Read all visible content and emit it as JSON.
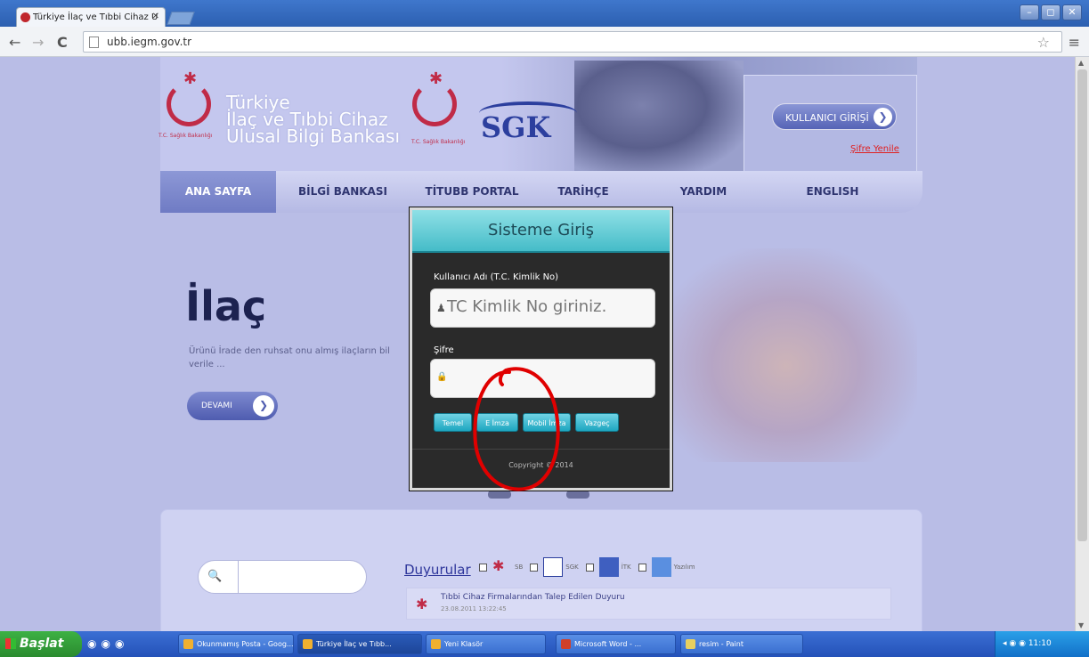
{
  "browser": {
    "tab_title": "Türkiye İlaç ve Tıbbi Cihaz U",
    "tab_close": "✕",
    "url": "ubb.iegm.gov.tr",
    "nav_back": "←",
    "nav_forward": "→",
    "nav_reload": "C",
    "star": "☆",
    "menu": "≡",
    "win_min": "–",
    "win_max": "◻",
    "win_close": "✕"
  },
  "site": {
    "logo_lines": [
      "Türkiye",
      "İlaç ve Tıbbi Cihaz",
      "Ulusal Bilgi Bankası"
    ],
    "logo_small": "T.C. Sağlık Bakanlığı",
    "sgk": "SGK",
    "login_button": "KULLANICI GİRİŞİ",
    "login_arrow": "❯",
    "password_reset_link": "Şifre Yenile",
    "nav": [
      "ANA SAYFA",
      "BİLGİ BANKASI",
      "TİTUBB PORTAL",
      "TARİHÇE",
      "YARDIM",
      "ENGLISH"
    ],
    "hero_title": "İlaç",
    "hero_desc": "Ürünü İrade den ruhsat onu almış ilaçların bil verile ...",
    "devami": "DEVAMI",
    "devami_arrow": "❯"
  },
  "modal": {
    "title": "Sisteme Giriş",
    "user_label": "Kullanıcı Adı (T.C. Kimlik No)",
    "user_placeholder": "TC Kimlik No giriniz.",
    "user_icon": "♟",
    "pass_label": "Şifre",
    "pass_icon": "🔒",
    "buttons": [
      "Temel",
      "E İmza",
      "Mobil İmza",
      "Vazgeç"
    ],
    "copyright": "Copyright © 2014"
  },
  "bottom": {
    "search_icon": "🔍",
    "duyurular": "Duyurular",
    "filters": [
      "SB",
      "SGK",
      "İTK",
      "Yazılım"
    ],
    "news_title": "Tıbbi Cihaz Firmalarından Talep Edilen Duyuru",
    "news_date": "23.08.2011 13:22:45"
  },
  "taskbar": {
    "start": "Başlat",
    "tasks": [
      "Okunmamış Posta - Goog...",
      "Türkiye İlaç ve Tıbb...",
      "Yeni Klasör",
      "Microsoft Word - ...",
      "resim - Paint"
    ],
    "clock": "11:10"
  }
}
